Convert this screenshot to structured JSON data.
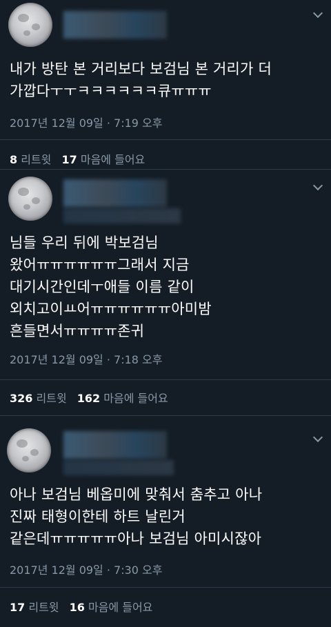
{
  "tweets": [
    {
      "text": "내가 방탄 본 거리보다 보검님 본 거리가 더\n가깝다ㅜㅜㅋㅋㅋㅋㅋㅋ큐ㅠㅠㅠ",
      "timestamp": "2017년 12월 09일 · 7:19 오후",
      "retweet_count": "8",
      "retweet_label": "리트윗",
      "like_count": "17",
      "like_label": "마음에 들어요"
    },
    {
      "text": "님들 우리 뒤에 박보검님\n왔어ㅠㅠㅠㅠㅠㅠ그래서 지금\n대기시간인데ㅜ애들 이름 같이\n외치고이ㅛ어ㅠㅠㅠㅠㅠㅠ아미밤\n흔들면서ㅠㅠㅠㅠ존귀",
      "timestamp": "2017년 12월 09일 · 7:18 오후",
      "retweet_count": "326",
      "retweet_label": "리트윗",
      "like_count": "162",
      "like_label": "마음에 들어요"
    },
    {
      "text": "아나 보검님 베옵미에 맞춰서 춤추고 아나\n진짜 태형이한테 하트 날린거\n같은데ㅠㅠㅠㅠㅠ아나 보검님 아미시잖아",
      "timestamp": "2017년 12월 09일 · 7:30 오후",
      "retweet_count": "17",
      "retweet_label": "리트윗",
      "like_count": "16",
      "like_label": "마음에 들어요"
    }
  ],
  "icons": {
    "avatar": "moon-avatar-icon",
    "menu": "chevron-down-icon"
  },
  "colors": {
    "background": "#141d26",
    "text": "#ffffff",
    "muted": "#8899a6",
    "divider": "#2b3a4a"
  }
}
